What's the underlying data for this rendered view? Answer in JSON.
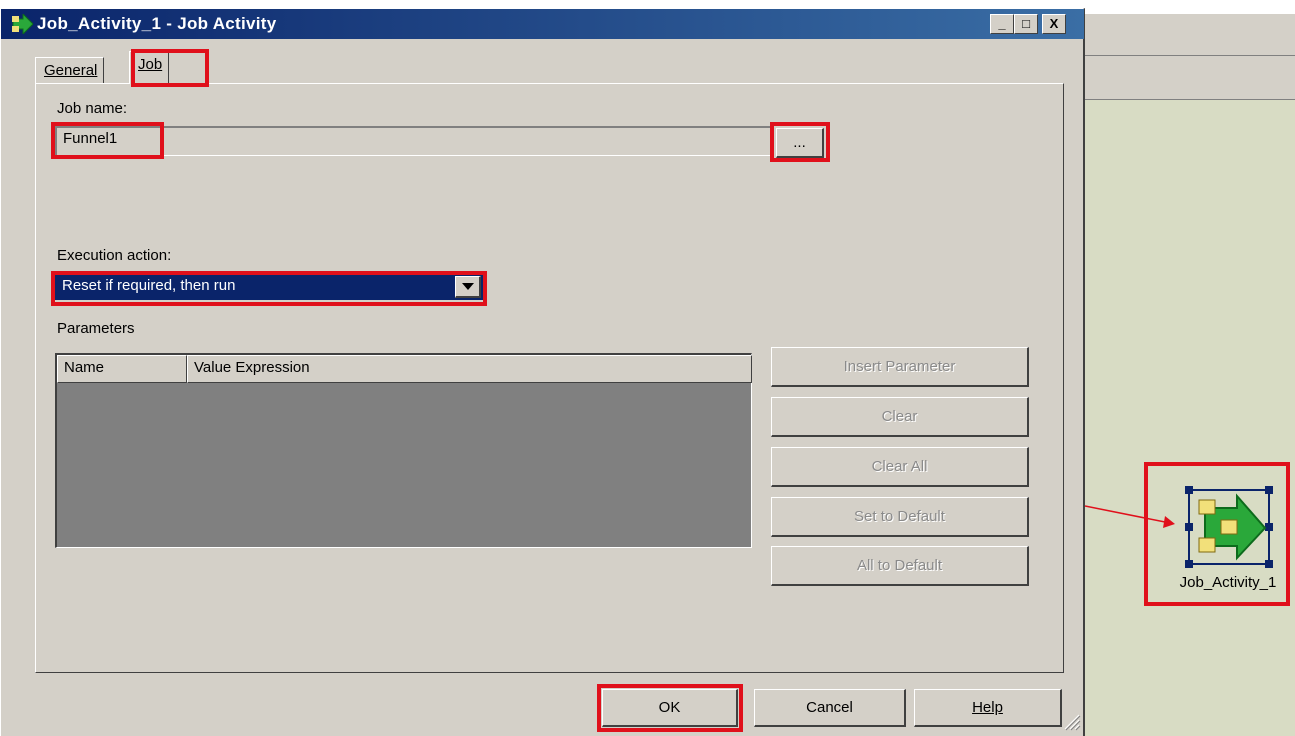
{
  "dialog": {
    "title": "Job_Activity_1 - Job Activity",
    "window_buttons": {
      "minimize": "_",
      "maximize": "□",
      "close": "X"
    }
  },
  "tabs": [
    {
      "label": "General",
      "selected": false
    },
    {
      "label": "Job",
      "selected": true
    }
  ],
  "job_name": {
    "label": "Job name:",
    "value": "Funnel1",
    "browse_label": "..."
  },
  "execution_action": {
    "label": "Execution action:",
    "selected_value": "Reset if required, then run"
  },
  "parameters": {
    "label": "Parameters",
    "columns": [
      "Name",
      "Value Expression"
    ],
    "rows": []
  },
  "side_buttons": {
    "insert_parameter": "Insert Parameter",
    "clear": "Clear",
    "clear_all": "Clear All",
    "set_to_default": "Set to Default",
    "all_to_default": "All to Default"
  },
  "footer": {
    "ok": "OK",
    "cancel": "Cancel",
    "help": "Help"
  },
  "canvas": {
    "activity_label": "Job_Activity_1"
  },
  "colors": {
    "highlight": "#e0101b",
    "titlebar": "#0a246a",
    "dropdown_selected": "#0a246a",
    "canvas_bg": "#d8dcc4"
  }
}
